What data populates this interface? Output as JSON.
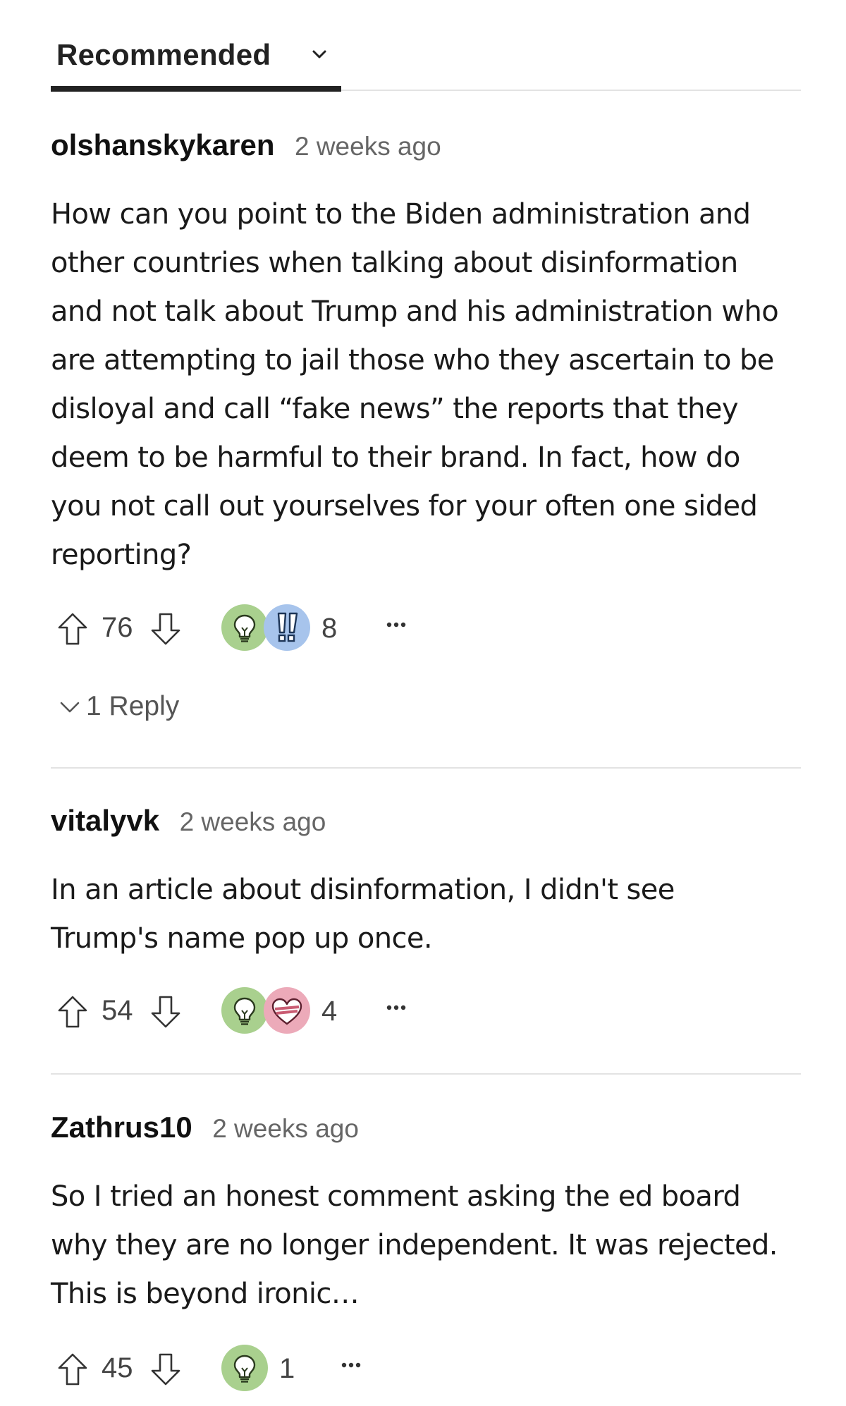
{
  "sort": {
    "label": "Recommended"
  },
  "comments": [
    {
      "author": "olshanskykaren",
      "time": "2 weeks ago",
      "body": "How can you point to the Biden administration and other countries when talking about disinformation and not talk about Trump and his administration who are attempting to jail those who they ascertain to be disloyal and call “fake news” the reports that they deem to be harmful to their brand. In fact, how do you not call out yourselves for your often one sided reporting?",
      "body_lines": [
        "How can you point to the Biden administration and",
        "other countries when talking about disinformation",
        "and not talk about Trump and his administration who",
        "are attempting to jail those who they ascertain to be",
        "disloyal and call “fake news” the reports that they",
        "deem to be harmful to their brand. In fact, how do",
        "you not call out yourselves for your often one sided",
        "reporting?"
      ],
      "votes": "76",
      "reactions": [
        "lightbulb-icon",
        "exclamation-icon"
      ],
      "reaction_count": "8",
      "replies": "1 Reply"
    },
    {
      "author": "vitalyvk",
      "time": "2 weeks ago",
      "body": "In an article about disinformation, I didn't see Trump's name pop up once.",
      "body_lines": [
        "In an article about disinformation, I didn't see",
        "Trump's name pop up once."
      ],
      "votes": "54",
      "reactions": [
        "lightbulb-icon",
        "heart-icon"
      ],
      "reaction_count": "4"
    },
    {
      "author": "Zathrus10",
      "time": "2 weeks ago",
      "body": "So I tried an honest comment asking the ed board why they are no longer independent. It was rejected. This is beyond ironic…",
      "body_lines": [
        "So I tried an honest comment asking the ed board",
        "why they are no longer independent. It was rejected.",
        "This is beyond ironic…"
      ],
      "votes": "45",
      "reactions": [
        "lightbulb-icon"
      ],
      "reaction_count": "1"
    }
  ],
  "colors": {
    "lightbulb_bg": "#a9d08e",
    "exclamation_bg": "#a7c4ec",
    "heart_bg": "#ecaab9",
    "divider": "#e3e3e3",
    "text": "#111111",
    "muted": "#666666"
  }
}
